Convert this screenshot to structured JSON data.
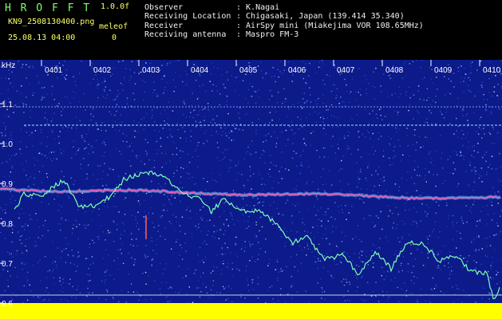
{
  "header": {
    "brand": "H R O F F T",
    "version": "1.0.0f",
    "filename": "KN9_2508130400.png",
    "meleo_label": "meleof",
    "meleo_value": "0",
    "datetime": "25.08.13 04:00",
    "fields": [
      {
        "label": "Observer",
        "value": ": K.Nagai"
      },
      {
        "label": "Receiving Location",
        "value": ": Chigasaki, Japan (139.414 35.340)"
      },
      {
        "label": "Receiver",
        "value": ": AirSpy mini (Miakejima VOR 108.65MHz)"
      },
      {
        "label": "Receiving antenna",
        "value": ": Maspro FM-3"
      }
    ]
  },
  "spectrogram": {
    "y_unit": "kHz",
    "y_ticks": [
      "1.1",
      "1.0",
      "0.9",
      "0.8",
      "0.7",
      "0.6"
    ],
    "x_ticks": [
      "0401",
      "0402",
      "0403",
      "0404",
      "0405",
      "0406",
      "0407",
      "0408",
      "0409",
      "0410"
    ],
    "colors": {
      "background": "#0c1a8a",
      "noise_light": "#6f9bff",
      "carrier": "#ff5ab4",
      "echo_trace": "#7dffb0",
      "axis": "#ffffff",
      "bottom_band": "#ffff00"
    }
  }
}
